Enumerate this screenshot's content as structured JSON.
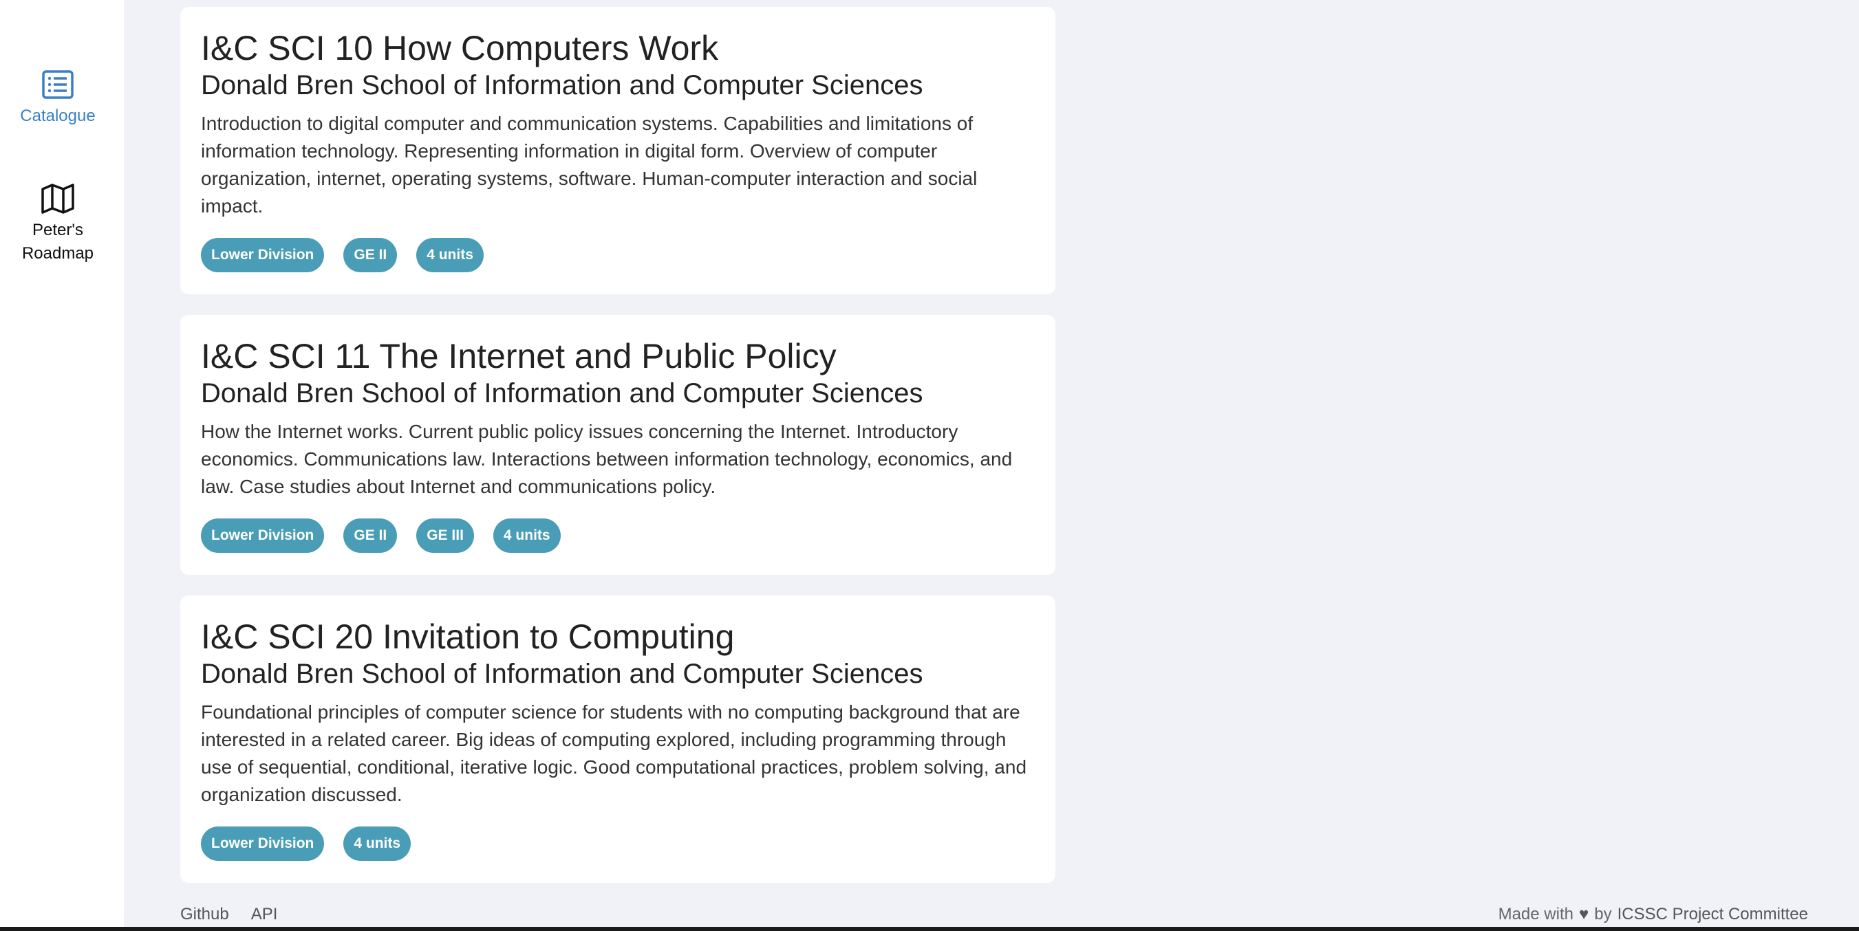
{
  "sidebar": {
    "items": [
      {
        "label": "Catalogue",
        "icon": "list-icon",
        "active": true
      },
      {
        "label": "Peter's\nRoadmap",
        "icon": "map-icon",
        "active": false
      }
    ]
  },
  "courses": [
    {
      "title": "I&C SCI 10 How Computers Work",
      "school": "Donald Bren School of Information and Computer Sciences",
      "description": "Introduction to digital computer and communication systems. Capabilities and limitations of information technology. Representing information in digital form. Overview of computer organization, internet, operating systems, software. Human-computer interaction and social impact.",
      "tags": [
        "Lower Division",
        "GE II",
        "4 units"
      ]
    },
    {
      "title": "I&C SCI 11 The Internet and Public Policy",
      "school": "Donald Bren School of Information and Computer Sciences",
      "description": "How the Internet works. Current public policy issues concerning the Internet. Introductory economics. Communications law. Interactions between information technology, economics, and law. Case studies about Internet and communications policy.",
      "tags": [
        "Lower Division",
        "GE II",
        "GE III",
        "4 units"
      ]
    },
    {
      "title": "I&C SCI 20 Invitation to Computing",
      "school": "Donald Bren School of Information and Computer Sciences",
      "description": "Foundational principles of computer science for students with no computing background that are interested in a related career. Big ideas of computing explored, including programming through use of sequential, conditional, iterative logic. Good computational practices, problem solving, and organization discussed.",
      "tags": [
        "Lower Division",
        "4 units"
      ]
    }
  ],
  "footer": {
    "links": [
      "Github",
      "API"
    ],
    "made_with": "Made with",
    "by": "by",
    "org": "ICSSC Project Committee"
  },
  "colors": {
    "accent": "#3a7fc6",
    "tag_bg": "#4a9db6",
    "page_bg": "#f0f2f7"
  }
}
